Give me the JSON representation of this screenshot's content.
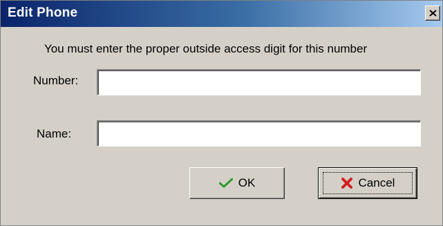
{
  "window": {
    "title": "Edit Phone",
    "close_glyph": "X"
  },
  "message": "You must enter the proper outside access digit for this number",
  "fields": {
    "number": {
      "label": "Number:",
      "value": ""
    },
    "name": {
      "label": "Name:",
      "value": ""
    }
  },
  "buttons": {
    "ok": {
      "label": "OK",
      "icon": "check-icon",
      "icon_color": "#2e9a2e"
    },
    "cancel": {
      "label": "Cancel",
      "icon": "x-icon",
      "icon_color": "#d42020"
    }
  },
  "colors": {
    "titlebar_start": "#0a246a",
    "titlebar_end": "#a6caf0",
    "face": "#d4d0c8"
  }
}
